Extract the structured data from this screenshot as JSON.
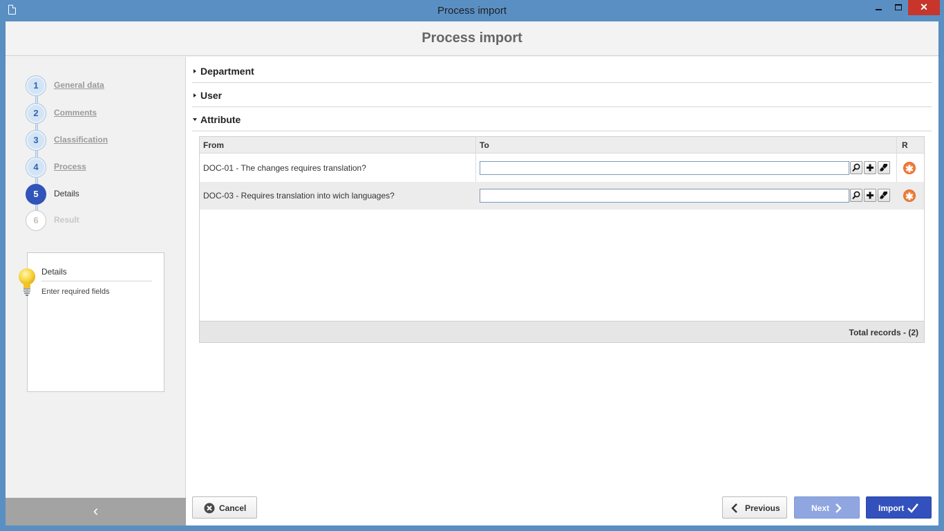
{
  "window": {
    "title": "Process import",
    "close_glyph": "✕"
  },
  "header": {
    "title": "Process import"
  },
  "steps": [
    {
      "number": "1",
      "label": "General data",
      "state": "done"
    },
    {
      "number": "2",
      "label": "Comments",
      "state": "done"
    },
    {
      "number": "3",
      "label": "Classification",
      "state": "done"
    },
    {
      "number": "4",
      "label": "Process",
      "state": "done"
    },
    {
      "number": "5",
      "label": "Details",
      "state": "active"
    },
    {
      "number": "6",
      "label": "Result",
      "state": "disabled"
    }
  ],
  "hint": {
    "title": "Details",
    "text": "Enter required fields",
    "icon": "lightbulb-icon"
  },
  "sidebar": {
    "collapse_glyph": "‹"
  },
  "sections": [
    {
      "title": "Department",
      "expanded": false
    },
    {
      "title": "User",
      "expanded": false
    },
    {
      "title": "Attribute",
      "expanded": true
    }
  ],
  "grid": {
    "columns": {
      "from": "From",
      "to": "To",
      "r": "R"
    },
    "rows": [
      {
        "from": "DOC-01 - The changes requires translation?",
        "to": ""
      },
      {
        "from": "DOC-03 - Requires translation into wich languages?",
        "to": ""
      }
    ],
    "total_label": "Total records",
    "total_value": " - (2)"
  },
  "buttons": {
    "cancel": "Cancel",
    "previous": "Previous",
    "next": "Next",
    "import": "Import"
  },
  "colors": {
    "accent": "#3351bd",
    "next_disabled": "#8fa6e0",
    "remove": "#ef7c3a",
    "titlebar": "#5a8fc4"
  }
}
